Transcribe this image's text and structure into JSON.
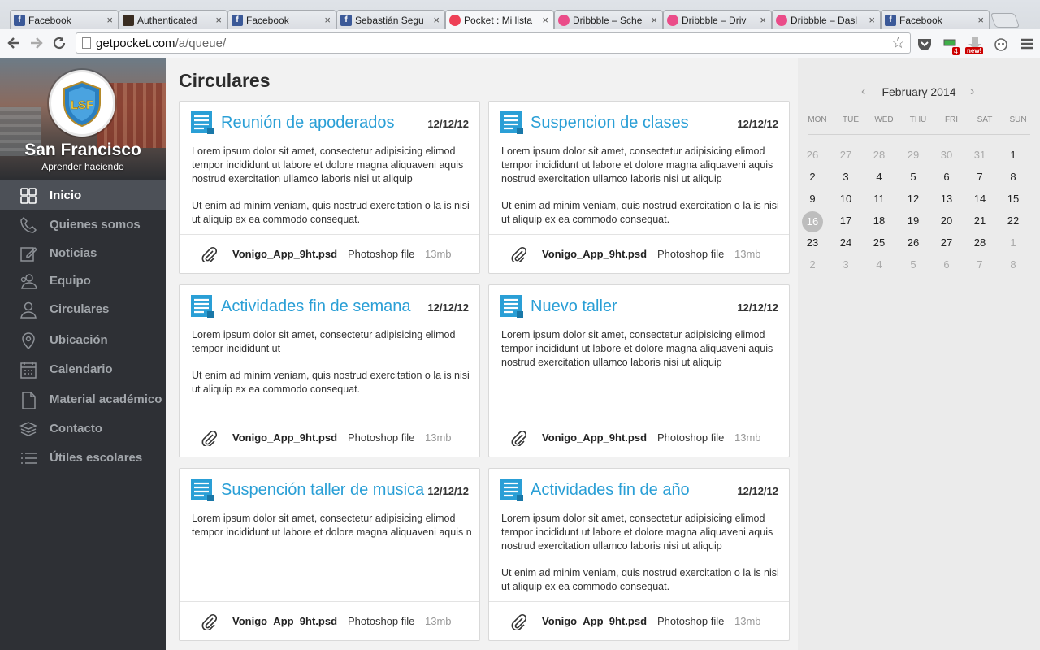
{
  "browser": {
    "tabs": [
      {
        "label": "Facebook",
        "favicon": "f",
        "favcolor": "#3b5998"
      },
      {
        "label": "Authenticated",
        "favicon": "",
        "favcolor": "#3a2d22"
      },
      {
        "label": "Facebook",
        "favicon": "f",
        "favcolor": "#3b5998"
      },
      {
        "label": "Sebastián Segu",
        "favicon": "f",
        "favcolor": "#3b5998"
      },
      {
        "label": "Pocket : Mi lista",
        "favicon": "",
        "favcolor": "#ee4056"
      },
      {
        "label": "Dribbble – Sche",
        "favicon": "",
        "favcolor": "#ea4c89"
      },
      {
        "label": "Dribbble – Driv",
        "favicon": "",
        "favcolor": "#ea4c89"
      },
      {
        "label": "Dribbble – Dasl",
        "favicon": "",
        "favcolor": "#ea4c89"
      },
      {
        "label": "Facebook",
        "favicon": "f",
        "favcolor": "#3b5998"
      }
    ],
    "close_glyph": "×",
    "url_host": "getpocket.com",
    "url_path": "/a/queue/",
    "ext_badge_count": "4",
    "ext_badge_new": "new!"
  },
  "sidebar": {
    "school_name": "San Francisco",
    "tagline": "Aprender haciendo",
    "logo_text": "LSF",
    "items": [
      {
        "label": "Inicio",
        "icon": "grid-icon"
      },
      {
        "label": "Quienes somos",
        "icon": "phone-icon"
      },
      {
        "label": "Noticias",
        "icon": "edit-icon"
      },
      {
        "label": "Equipo",
        "icon": "team-icon"
      },
      {
        "label": "Circulares",
        "icon": "user-icon"
      },
      {
        "label": "Ubicación",
        "icon": "location-pin-icon"
      },
      {
        "label": "Calendario",
        "icon": "calendar-icon"
      },
      {
        "label": "Material académico",
        "icon": "document-icon"
      },
      {
        "label": "Contacto",
        "icon": "layers-icon"
      },
      {
        "label": "Útiles escolares",
        "icon": "list-icon"
      }
    ]
  },
  "main": {
    "title": "Circulares",
    "cards": [
      {
        "title": "Reunión de apoderados",
        "date": "12/12/12",
        "paragraphs": [
          "Lorem ipsum dolor sit amet, consectetur adipisicing elimod tempor incididunt ut labore et dolore magna aliquaveni aquis nostrud exercitation ullamco laboris nisi ut aliquip",
          "Ut enim ad minim veniam, quis nostrud exercitation o la is nisi ut aliquip ex ea commodo consequat."
        ],
        "file": "Vonigo_App_9ht.psd",
        "type": "Photoshop file",
        "size": "13mb"
      },
      {
        "title": "Suspencion de clases",
        "date": "12/12/12",
        "paragraphs": [
          "Lorem ipsum dolor sit amet, consectetur adipisicing elimod tempor incididunt ut labore et dolore magna aliquaveni aquis nostrud exercitation ullamco laboris nisi ut aliquip",
          "Ut enim ad minim veniam, quis nostrud exercitation o la is nisi ut aliquip ex ea commodo consequat."
        ],
        "file": "Vonigo_App_9ht.psd",
        "type": "Photoshop file",
        "size": "13mb"
      },
      {
        "title": "Actividades fin de semana",
        "date": "12/12/12",
        "paragraphs": [
          "Lorem ipsum dolor sit amet, consectetur adipisicing elimod tempor incididunt ut",
          "Ut enim ad minim veniam, quis nostrud exercitation o la is nisi ut aliquip ex ea commodo consequat."
        ],
        "file": "Vonigo_App_9ht.psd",
        "type": "Photoshop file",
        "size": "13mb"
      },
      {
        "title": "Nuevo taller",
        "date": "12/12/12",
        "paragraphs": [
          "Lorem ipsum dolor sit amet, consectetur adipisicing elimod tempor incididunt ut labore et dolore magna aliquaveni aquis nostrud exercitation ullamco laboris nisi ut aliquip"
        ],
        "file": "Vonigo_App_9ht.psd",
        "type": "Photoshop file",
        "size": "13mb"
      },
      {
        "title": "Suspención taller de musica",
        "date": "12/12/12",
        "paragraphs": [
          "Lorem ipsum dolor sit amet, consectetur adipisicing elimod tempor incididunt ut labore et dolore magna aliquaveni aquis n"
        ],
        "file": "Vonigo_App_9ht.psd",
        "type": "Photoshop file",
        "size": "13mb"
      },
      {
        "title": "Actividades fin de año",
        "date": "12/12/12",
        "paragraphs": [
          "Lorem ipsum dolor sit amet, consectetur adipisicing elimod tempor incididunt ut labore et dolore magna aliquaveni aquis nostrud exercitation ullamco laboris nisi ut aliquip",
          "Ut enim ad minim veniam, quis nostrud exercitation o la is nisi ut aliquip ex ea commodo consequat."
        ],
        "file": "Vonigo_App_9ht.psd",
        "type": "Photoshop file",
        "size": "13mb"
      }
    ]
  },
  "calendar": {
    "month": "February 2014",
    "prev": "‹",
    "next": "›",
    "weekdays": [
      "MON",
      "TUE",
      "WED",
      "THU",
      "FRI",
      "SAT",
      "SUN"
    ],
    "weeks": [
      [
        "26",
        "27",
        "28",
        "29",
        "30",
        "31",
        "1"
      ],
      [
        "2",
        "3",
        "4",
        "5",
        "6",
        "7",
        "8"
      ],
      [
        "9",
        "10",
        "11",
        "12",
        "13",
        "14",
        "15"
      ],
      [
        "16",
        "17",
        "18",
        "19",
        "20",
        "21",
        "22"
      ],
      [
        "23",
        "24",
        "25",
        "26",
        "27",
        "28",
        "1"
      ],
      [
        "2",
        "3",
        "4",
        "5",
        "6",
        "7",
        "8"
      ]
    ],
    "today": "16",
    "colors": {
      "accent": "#2a9fd6",
      "today": "#bdbdbd"
    }
  }
}
